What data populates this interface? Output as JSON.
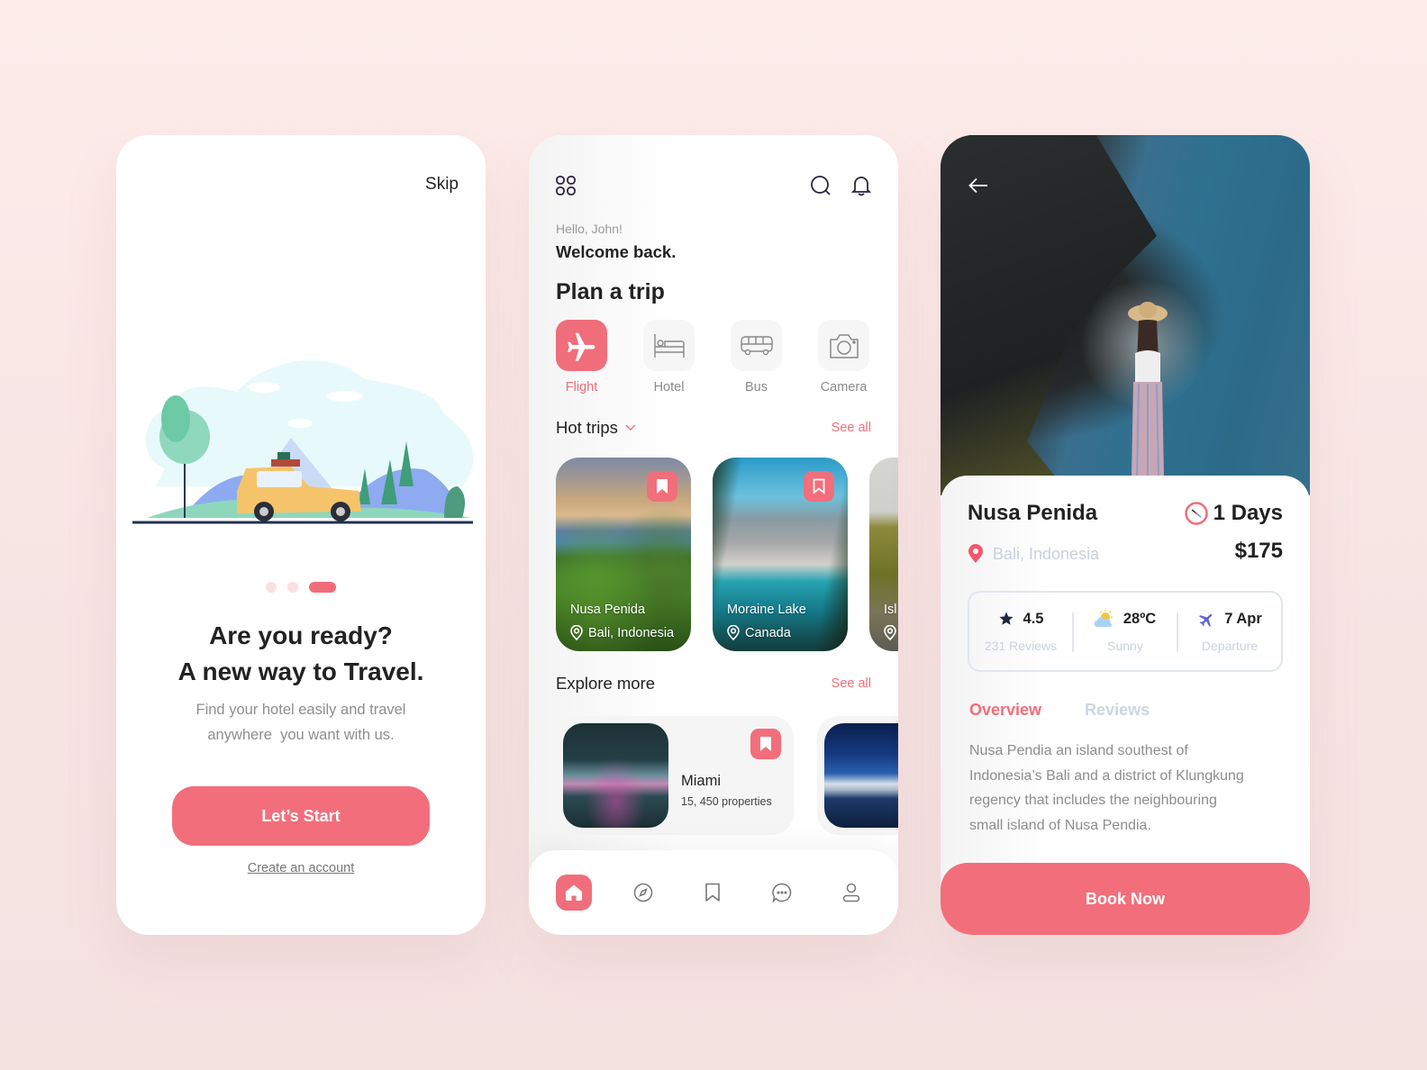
{
  "colors": {
    "accent": "#F26E7B",
    "accent_light": "#FCDFE1",
    "text_dark": "#222222",
    "text_muted": "#8E8E8E",
    "text_faint": "#C9D1DE",
    "background": "#FDECEA"
  },
  "onboarding": {
    "skip_label": "Skip",
    "illustration": "family-road-trip-car-illustration",
    "pager": {
      "total": 3,
      "active_index": 2
    },
    "title_line1": "Are you ready?",
    "title_line2": "A new way to Travel.",
    "subtitle_line1": "Find your hotel easily and travel",
    "subtitle_line2": "anywhere  you want with us.",
    "start_button": "Let’s Start",
    "create_account_link": "Create an account"
  },
  "home": {
    "header_icons": [
      "grid-menu-icon",
      "search-icon",
      "bell-icon"
    ],
    "greeting": "Hello, John!",
    "welcome": "Welcome back.",
    "plan_title": "Plan a trip",
    "categories": [
      {
        "label": "Flight",
        "icon": "airplane-icon",
        "active": true
      },
      {
        "label": "Hotel",
        "icon": "bed-icon",
        "active": false
      },
      {
        "label": "Bus",
        "icon": "bus-icon",
        "active": false
      },
      {
        "label": "Camera",
        "icon": "camera-icon",
        "active": false
      }
    ],
    "hot_trips": {
      "title": "Hot trips",
      "see_all": "See all",
      "items": [
        {
          "name": "Nusa Penida",
          "location": "Bali, Indonesia",
          "bookmarked": true
        },
        {
          "name": "Moraine Lake",
          "location": "Canada",
          "bookmarked": false
        },
        {
          "name": "Isl",
          "location": ""
        }
      ]
    },
    "explore_more": {
      "title": "Explore more",
      "see_all": "See all",
      "items": [
        {
          "name": "Miami",
          "properties": "15, 450 properties",
          "bookmarked": true
        },
        {
          "name": "",
          "properties": ""
        }
      ]
    },
    "bottom_nav": [
      {
        "icon": "home-icon",
        "active": true
      },
      {
        "icon": "compass-icon",
        "active": false
      },
      {
        "icon": "bookmark-icon",
        "active": false
      },
      {
        "icon": "chat-icon",
        "active": false
      },
      {
        "icon": "profile-icon",
        "active": false
      }
    ]
  },
  "detail": {
    "title": "Nusa Penida",
    "duration": "1 Days",
    "location": "Bali, Indonesia",
    "price": "$175",
    "stats": [
      {
        "icon": "star-icon",
        "value": "4.5",
        "label": "231 Reviews"
      },
      {
        "icon": "partly-sunny-icon",
        "value": "28ºC",
        "label": "Sunny"
      },
      {
        "icon": "airplane-icon",
        "value": "7 Apr",
        "label": "Departure"
      }
    ],
    "tabs": [
      {
        "label": "Overview",
        "active": true
      },
      {
        "label": "Reviews",
        "active": false
      }
    ],
    "description_lines": [
      "Nusa Pendia an island southest of",
      "Indonesia’s Bali and a district of Klungkung",
      "regency that includes the neighbouring",
      "small island of Nusa Pendia."
    ],
    "book_button": "Book Now"
  }
}
